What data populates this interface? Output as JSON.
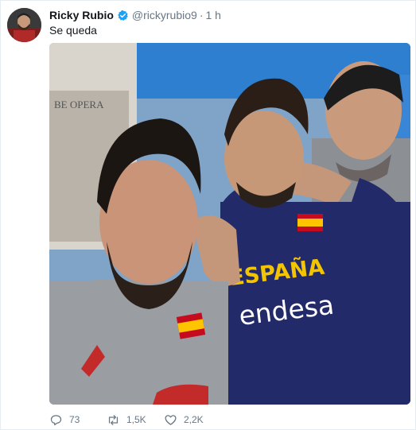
{
  "tweet": {
    "author_name": "Ricky Rubio",
    "verified": true,
    "handle": "@rickyrubio9",
    "separator": "·",
    "time": "1 h",
    "text": "Se queda",
    "media": {
      "jersey_text": "ESPAÑA",
      "sponsor_text": "endesa",
      "background_text": "BE OPERA"
    },
    "actions": {
      "replies": "73",
      "retweets": "1,5K",
      "likes": "2,2K"
    }
  },
  "colors": {
    "verified_blue": "#1da1f2",
    "muted": "#657786",
    "jersey_navy": "#222a6b",
    "jersey_yellow": "#f2c500"
  },
  "icons": [
    "verified-badge-icon",
    "reply-icon",
    "retweet-icon",
    "like-icon"
  ]
}
